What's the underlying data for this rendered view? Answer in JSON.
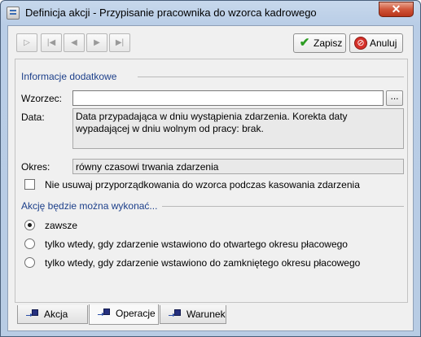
{
  "window": {
    "title": "Definicja akcji - Przypisanie pracownika do wzorca kadrowego",
    "close_symbol": "✕"
  },
  "toolbar": {
    "nav_buttons": [
      {
        "name": "new-record-icon",
        "glyph": "▷"
      },
      {
        "name": "first-record-icon",
        "glyph": "|◀"
      },
      {
        "name": "previous-record-icon",
        "glyph": "◀"
      },
      {
        "name": "next-record-icon",
        "glyph": "▶"
      },
      {
        "name": "last-record-icon",
        "glyph": "▶|"
      }
    ],
    "save_label": "Zapisz",
    "cancel_label": "Anuluj",
    "save_icon": "✔",
    "cancel_icon": "⊘"
  },
  "form": {
    "section_info": "Informacje dodatkowe",
    "pattern_label": "Wzorzec:",
    "pattern_value": "",
    "pattern_button": "...",
    "date_label": "Data:",
    "date_value": "Data przypadająca w dniu wystąpienia zdarzenia. Korekta daty wypadającej w dniu wolnym od pracy: brak.",
    "period_label": "Okres:",
    "period_value": "równy czasowi trwania zdarzenia",
    "keep_assignment_label": "Nie usuwaj przyporządkowania do wzorca podczas kasowania zdarzenia",
    "keep_assignment_checked": false,
    "section_execution": "Akcję będzie można wykonać...",
    "options": [
      {
        "label": "zawsze",
        "checked": true
      },
      {
        "label": "tylko wtedy, gdy zdarzenie wstawiono do otwartego okresu płacowego",
        "checked": false
      },
      {
        "label": "tylko wtedy, gdy zdarzenie wstawiono do zamkniętego okresu płacowego",
        "checked": false
      }
    ]
  },
  "tabs": [
    {
      "label": "Akcja",
      "active": false
    },
    {
      "label": "Operacje",
      "active": true
    },
    {
      "label": "Warunek",
      "active": false
    }
  ],
  "colors": {
    "section_title": "#1c3f8a",
    "accent_check": "#2c9c22",
    "accent_cancel": "#d5312a"
  }
}
